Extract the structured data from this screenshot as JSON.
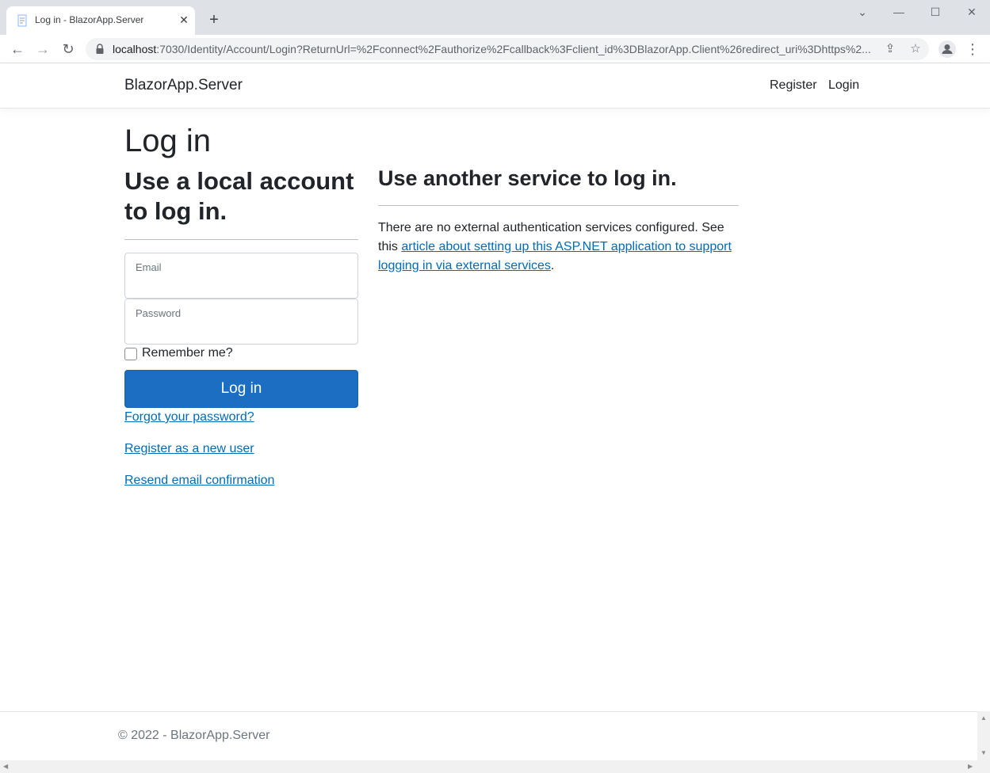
{
  "browser": {
    "tab_title": "Log in - BlazorApp.Server",
    "url_host": "localhost",
    "url_rest": ":7030/Identity/Account/Login?ReturnUrl=%2Fconnect%2Fauthorize%2Fcallback%3Fclient_id%3DBlazorApp.Client%26redirect_uri%3Dhttps%2..."
  },
  "navbar": {
    "brand": "BlazorApp.Server",
    "register": "Register",
    "login": "Login"
  },
  "page": {
    "title": "Log in",
    "local_heading": "Use a local account to log in.",
    "external_heading": "Use another service to log in.",
    "email_label": "Email",
    "password_label": "Password",
    "remember_label": "Remember me?",
    "login_button": "Log in",
    "forgot_link": "Forgot your password?",
    "register_link": "Register as a new user",
    "resend_link": "Resend email confirmation",
    "info_text_before": "There are no external authentication services configured. See this ",
    "info_link": "article about setting up this ASP.NET application to support logging in via external services",
    "info_text_after": "."
  },
  "footer": {
    "text": "© 2022 - BlazorApp.Server"
  },
  "colors": {
    "primary": "#1b6ec2",
    "link": "#006bb7"
  }
}
